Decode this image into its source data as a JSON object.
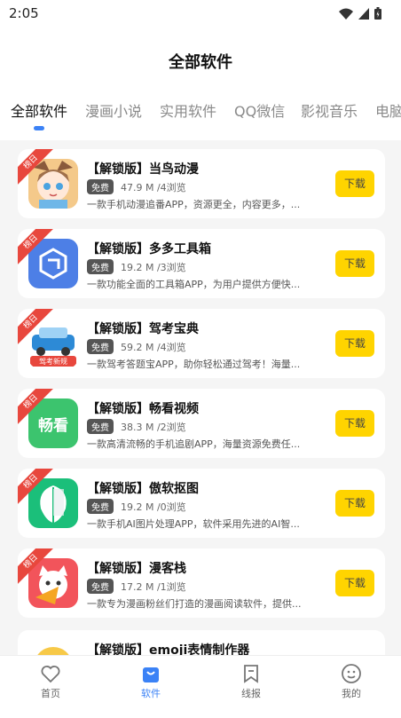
{
  "status_bar": {
    "time": "2:05"
  },
  "header": {
    "title": "全部软件"
  },
  "tabs": [
    {
      "label": "全部软件",
      "active": true
    },
    {
      "label": "漫画小说"
    },
    {
      "label": "实用软件"
    },
    {
      "label": "QQ微信"
    },
    {
      "label": "影视音乐"
    },
    {
      "label": "电脑"
    }
  ],
  "apps": [
    {
      "badge": "榜日",
      "name": "【解锁版】当鸟动漫",
      "free": "免费",
      "size_views": "47.9 M /4浏览",
      "desc": "一款手机动漫追番APP，资源更全，内容更多，...",
      "download": "下载",
      "icon": "anime-avatar-icon"
    },
    {
      "badge": "榜日",
      "name": "【解锁版】多多工具箱",
      "free": "免费",
      "size_views": "19.2 M /3浏览",
      "desc": "一款功能全面的工具箱APP，为用户提供方便快...",
      "download": "下载",
      "icon": "toolbox-icon"
    },
    {
      "badge": "榜日",
      "name": "【解锁版】驾考宝典",
      "free": "免费",
      "size_views": "59.2 M /4浏览",
      "desc": "一款驾考答题宝APP，助你轻松通过驾考！海量...",
      "download": "下载",
      "icon": "car-icon",
      "icon_caption": "驾考新规"
    },
    {
      "badge": "榜日",
      "name": "【解锁版】畅看视频",
      "free": "免费",
      "size_views": "38.3 M /2浏览",
      "desc": "一款高清流畅的手机追剧APP，海量资源免费任...",
      "download": "下载",
      "icon": "video-icon",
      "icon_text": "畅看"
    },
    {
      "badge": "榜日",
      "name": "【解锁版】傲软抠图",
      "free": "免费",
      "size_views": "19.2 M /0浏览",
      "desc": "一款手机AI图片处理APP，软件采用先进的AI智...",
      "download": "下载",
      "icon": "cutout-icon"
    },
    {
      "badge": "榜日",
      "name": "【解锁版】漫客栈",
      "free": "免费",
      "size_views": "17.2 M /1浏览",
      "desc": "一款专为漫画粉丝们打造的漫画阅读软件，提供...",
      "download": "下载",
      "icon": "cat-comic-icon"
    },
    {
      "badge": "",
      "name": "【解锁版】emoji表情制作器",
      "free": "",
      "size_views": "",
      "desc": "",
      "download": "",
      "icon": "emoji-icon"
    }
  ],
  "bottom_nav": [
    {
      "label": "首页",
      "icon": "heart-icon"
    },
    {
      "label": "软件",
      "icon": "bag-icon",
      "active": true
    },
    {
      "label": "线报",
      "icon": "bookmark-icon"
    },
    {
      "label": "我的",
      "icon": "smiley-icon"
    }
  ],
  "colors": {
    "accent": "#3b82f6",
    "download": "#ffd400",
    "badge": "#e8473d"
  }
}
